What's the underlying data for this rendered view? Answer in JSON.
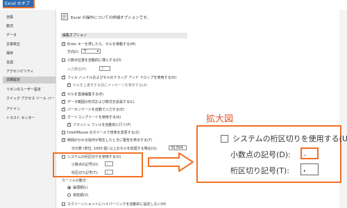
{
  "window": {
    "title": "Excel のオプション"
  },
  "nav": {
    "items": [
      "全般",
      "数式",
      "データ",
      "文章校正",
      "保存",
      "言語",
      "アクセシビリティ",
      "詳細設定",
      "リボンのユーザー設定",
      "クイック アクセス ツール バー",
      "アドイン",
      "トラスト センター"
    ],
    "selected": "詳細設定"
  },
  "content": {
    "header": "Excel の操作についての詳細オプションです。",
    "section_edit": "編集オプション",
    "opt_enter_move": "Enter キーを押したら、セルを移動する(M)",
    "direction_label": "方向(I):",
    "direction_value": "下",
    "opt_auto_decimal": "小数点位置を自動的に挿入する(D)",
    "decimal_places_label": "入力単位(P):",
    "decimal_places_value": "2",
    "opt_fill_handle": "フィル ハンドルおよびセルのドラッグ アンド ドロップを使用する(D)",
    "opt_alert_overwrite": "セルを上書きする前にメッセージを表示する(A)",
    "opt_edit_in_cell": "セルを直接編集する(E)",
    "opt_extend_format": "データ範囲の形式および数式を拡張する(L)",
    "opt_percent": "パーセンテージを自動で入力する(E)",
    "opt_autocomplete": "オートコンプリートを使用する(A)",
    "opt_flash_fill": "フラッシュ フィルを自動的に行う(F)",
    "opt_intellimouse": "IntelliMouse のホイールで倍率を変更する(Z)",
    "opt_alert_slow": "時間がかかる操作が発生したときに警告を表示する(T)",
    "cells_label": "次の数 (単位: 1000 個) 以上のセルを処理する場合(U):",
    "cells_value": "33,554",
    "opt_system_sep": "システムの桁区切りを使用する(U)",
    "decimal_sep_label": "小数点の記号(D):",
    "decimal_sep_value": ".",
    "thousands_sep_label": "桁区切り記号(T):",
    "thousands_sep_value": ",",
    "cursor_label": "カーソルの動き:",
    "cursor_logical": "論理順(L)",
    "cursor_visual": "視覚順(V)",
    "opt_screenshot": "スクリーンショットにハイパーリンクを自動的に設定しない(H)"
  },
  "zoom": {
    "title": "拡大図",
    "opt_system_sep": "システムの桁区切りを使用する(U)",
    "decimal_sep_label": "小数点の記号(D):",
    "decimal_sep_value": ".",
    "thousands_sep_label": "桁区切り記号(T):",
    "thousands_sep_value": ","
  },
  "colors": {
    "accent": "#f36f21",
    "title_bg": "#2e6ab3",
    "zoom_title": "#e0532a"
  }
}
